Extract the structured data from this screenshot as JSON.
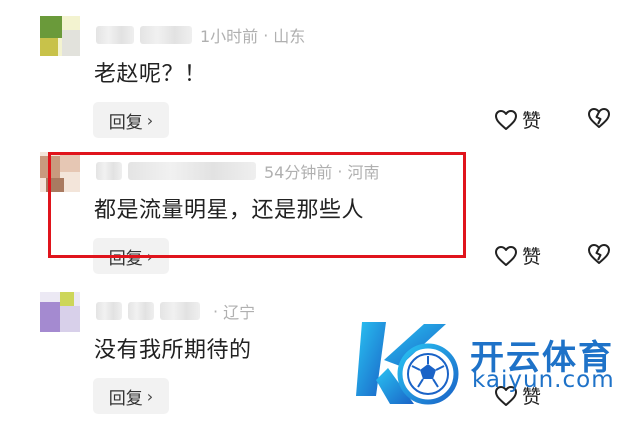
{
  "comments": [
    {
      "time": "1小时前",
      "sep": "·",
      "location": "山东",
      "text": "老赵呢？！",
      "reply_label": "回复",
      "reply_chevron": "›",
      "like_label": "赞",
      "avatar_colors": [
        "#f3f3d0",
        "#6a9a3a",
        "#c8c24a",
        "#d8d8d8"
      ]
    },
    {
      "time": "54分钟前",
      "sep": "·",
      "location": "河南",
      "text": "都是流量明星，还是那些人",
      "reply_label": "回复",
      "reply_chevron": "›",
      "like_label": "赞",
      "highlighted": true,
      "avatar_colors": [
        "#c99a7e",
        "#e6c7b4",
        "#a97a60",
        "#f3e5da"
      ]
    },
    {
      "time": "",
      "sep": "·",
      "location": "辽宁",
      "text": "没有我所期待的",
      "reply_label": "回复",
      "reply_chevron": "›",
      "like_label": "赞",
      "avatar_colors": [
        "#a48ad0",
        "#d8d0ea",
        "#cdd65a",
        "#ece9f4"
      ]
    }
  ],
  "watermark": {
    "brand": "开云体育",
    "url": "kaiyun.com"
  },
  "icons": {
    "like": "heart-outline-icon",
    "dislike": "broken-heart-icon",
    "reply_chevron": "chevron-right-icon"
  },
  "colors": {
    "highlight_border": "#e0141c",
    "watermark_blue": "#1e72c8",
    "meta_gray": "#b0b0b0"
  }
}
